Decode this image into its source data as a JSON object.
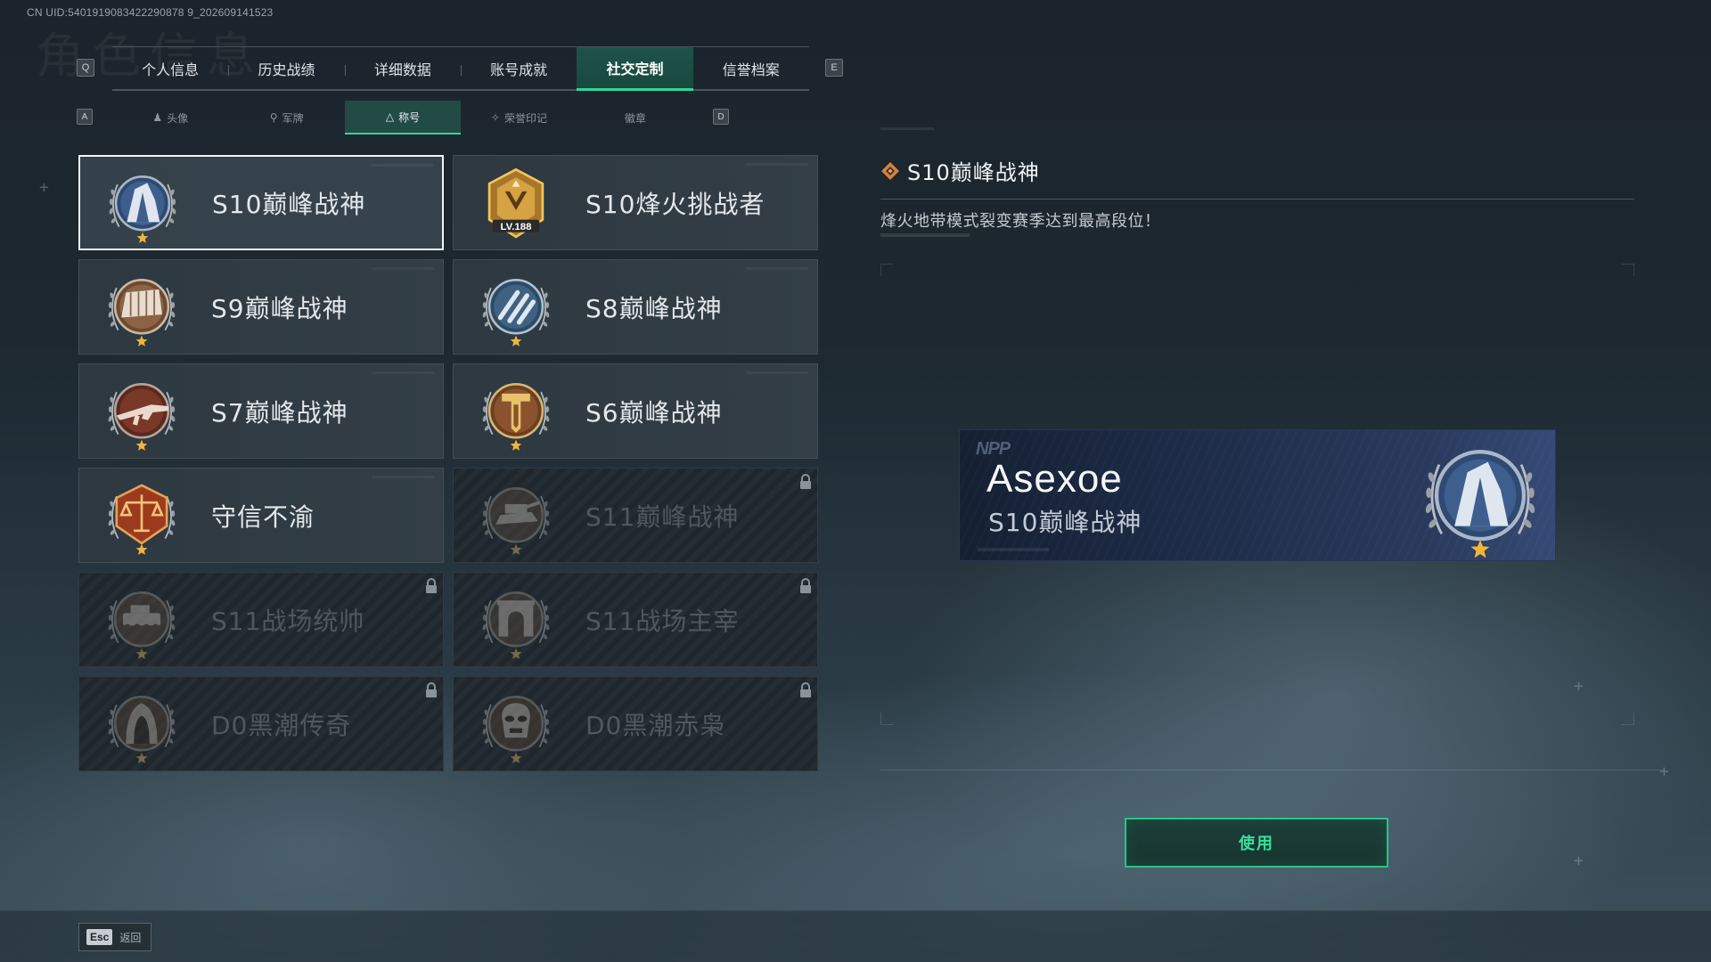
{
  "uid": "CN UID:5401919083422290878 9_202609141523",
  "bg_title": "角色信息",
  "keys": {
    "prev_main": "Q",
    "next_main": "E",
    "prev_sub": "A",
    "next_sub": "D"
  },
  "main_tabs": [
    {
      "label": "个人信息",
      "active": false
    },
    {
      "label": "历史战绩",
      "active": false
    },
    {
      "label": "详细数据",
      "active": false
    },
    {
      "label": "账号成就",
      "active": false
    },
    {
      "label": "社交定制",
      "active": true
    },
    {
      "label": "信誉档案",
      "active": false
    }
  ],
  "sub_tabs": [
    {
      "label": "头像",
      "icon": "person-icon",
      "active": false
    },
    {
      "label": "军牌",
      "icon": "dogtag-icon",
      "active": false
    },
    {
      "label": "称号",
      "icon": "triangle-icon",
      "active": true
    },
    {
      "label": "荣誉印记",
      "icon": "laurel-icon",
      "active": false
    },
    {
      "label": "徽章",
      "icon": "",
      "active": false
    }
  ],
  "titles": [
    {
      "label": "S10巅峰战神",
      "badge": "s10-tower-badge-icon",
      "state": "selected"
    },
    {
      "label": "S10烽火挑战者",
      "badge": "s10-challenger-badge-icon",
      "level": "LV.188",
      "state": "unlocked"
    },
    {
      "label": "S9巅峰战神",
      "badge": "s9-dam-badge-icon",
      "state": "unlocked"
    },
    {
      "label": "S8巅峰战神",
      "badge": "s8-stripes-badge-icon",
      "state": "unlocked"
    },
    {
      "label": "S7巅峰战神",
      "badge": "s7-rifle-badge-icon",
      "state": "unlocked"
    },
    {
      "label": "S6巅峰战神",
      "badge": "s6-shield-badge-icon",
      "state": "unlocked"
    },
    {
      "label": "守信不渝",
      "badge": "scales-badge-icon",
      "state": "unlocked"
    },
    {
      "label": "S11巅峰战神",
      "badge": "s11-tank-badge-icon",
      "state": "locked"
    },
    {
      "label": "S11战场统帅",
      "badge": "s11-vehicle-badge-icon",
      "state": "locked"
    },
    {
      "label": "S11战场主宰",
      "badge": "s11-arch-badge-icon",
      "state": "locked"
    },
    {
      "label": "D0黑潮传奇",
      "badge": "hooded-figure-badge-icon",
      "state": "locked"
    },
    {
      "label": "D0黑潮赤枭",
      "badge": "skull-mask-badge-icon",
      "state": "locked"
    }
  ],
  "detail": {
    "title": "S10巅峰战神",
    "description": "烽火地带模式裂变赛季达到最高段位！",
    "icon": "diamond-marker-icon"
  },
  "nameplate": {
    "logo": "NPP",
    "player_name": "Asexoe",
    "title": "S10巅峰战神",
    "badge": "s10-tower-badge-icon"
  },
  "use_button": "使用",
  "back": {
    "key": "Esc",
    "label": "返回"
  },
  "colors": {
    "accent": "#2fd79a",
    "gold_star": "#f0b53a",
    "badge_blue": "#4a6e9e",
    "badge_bronze": "#8a5a35"
  }
}
